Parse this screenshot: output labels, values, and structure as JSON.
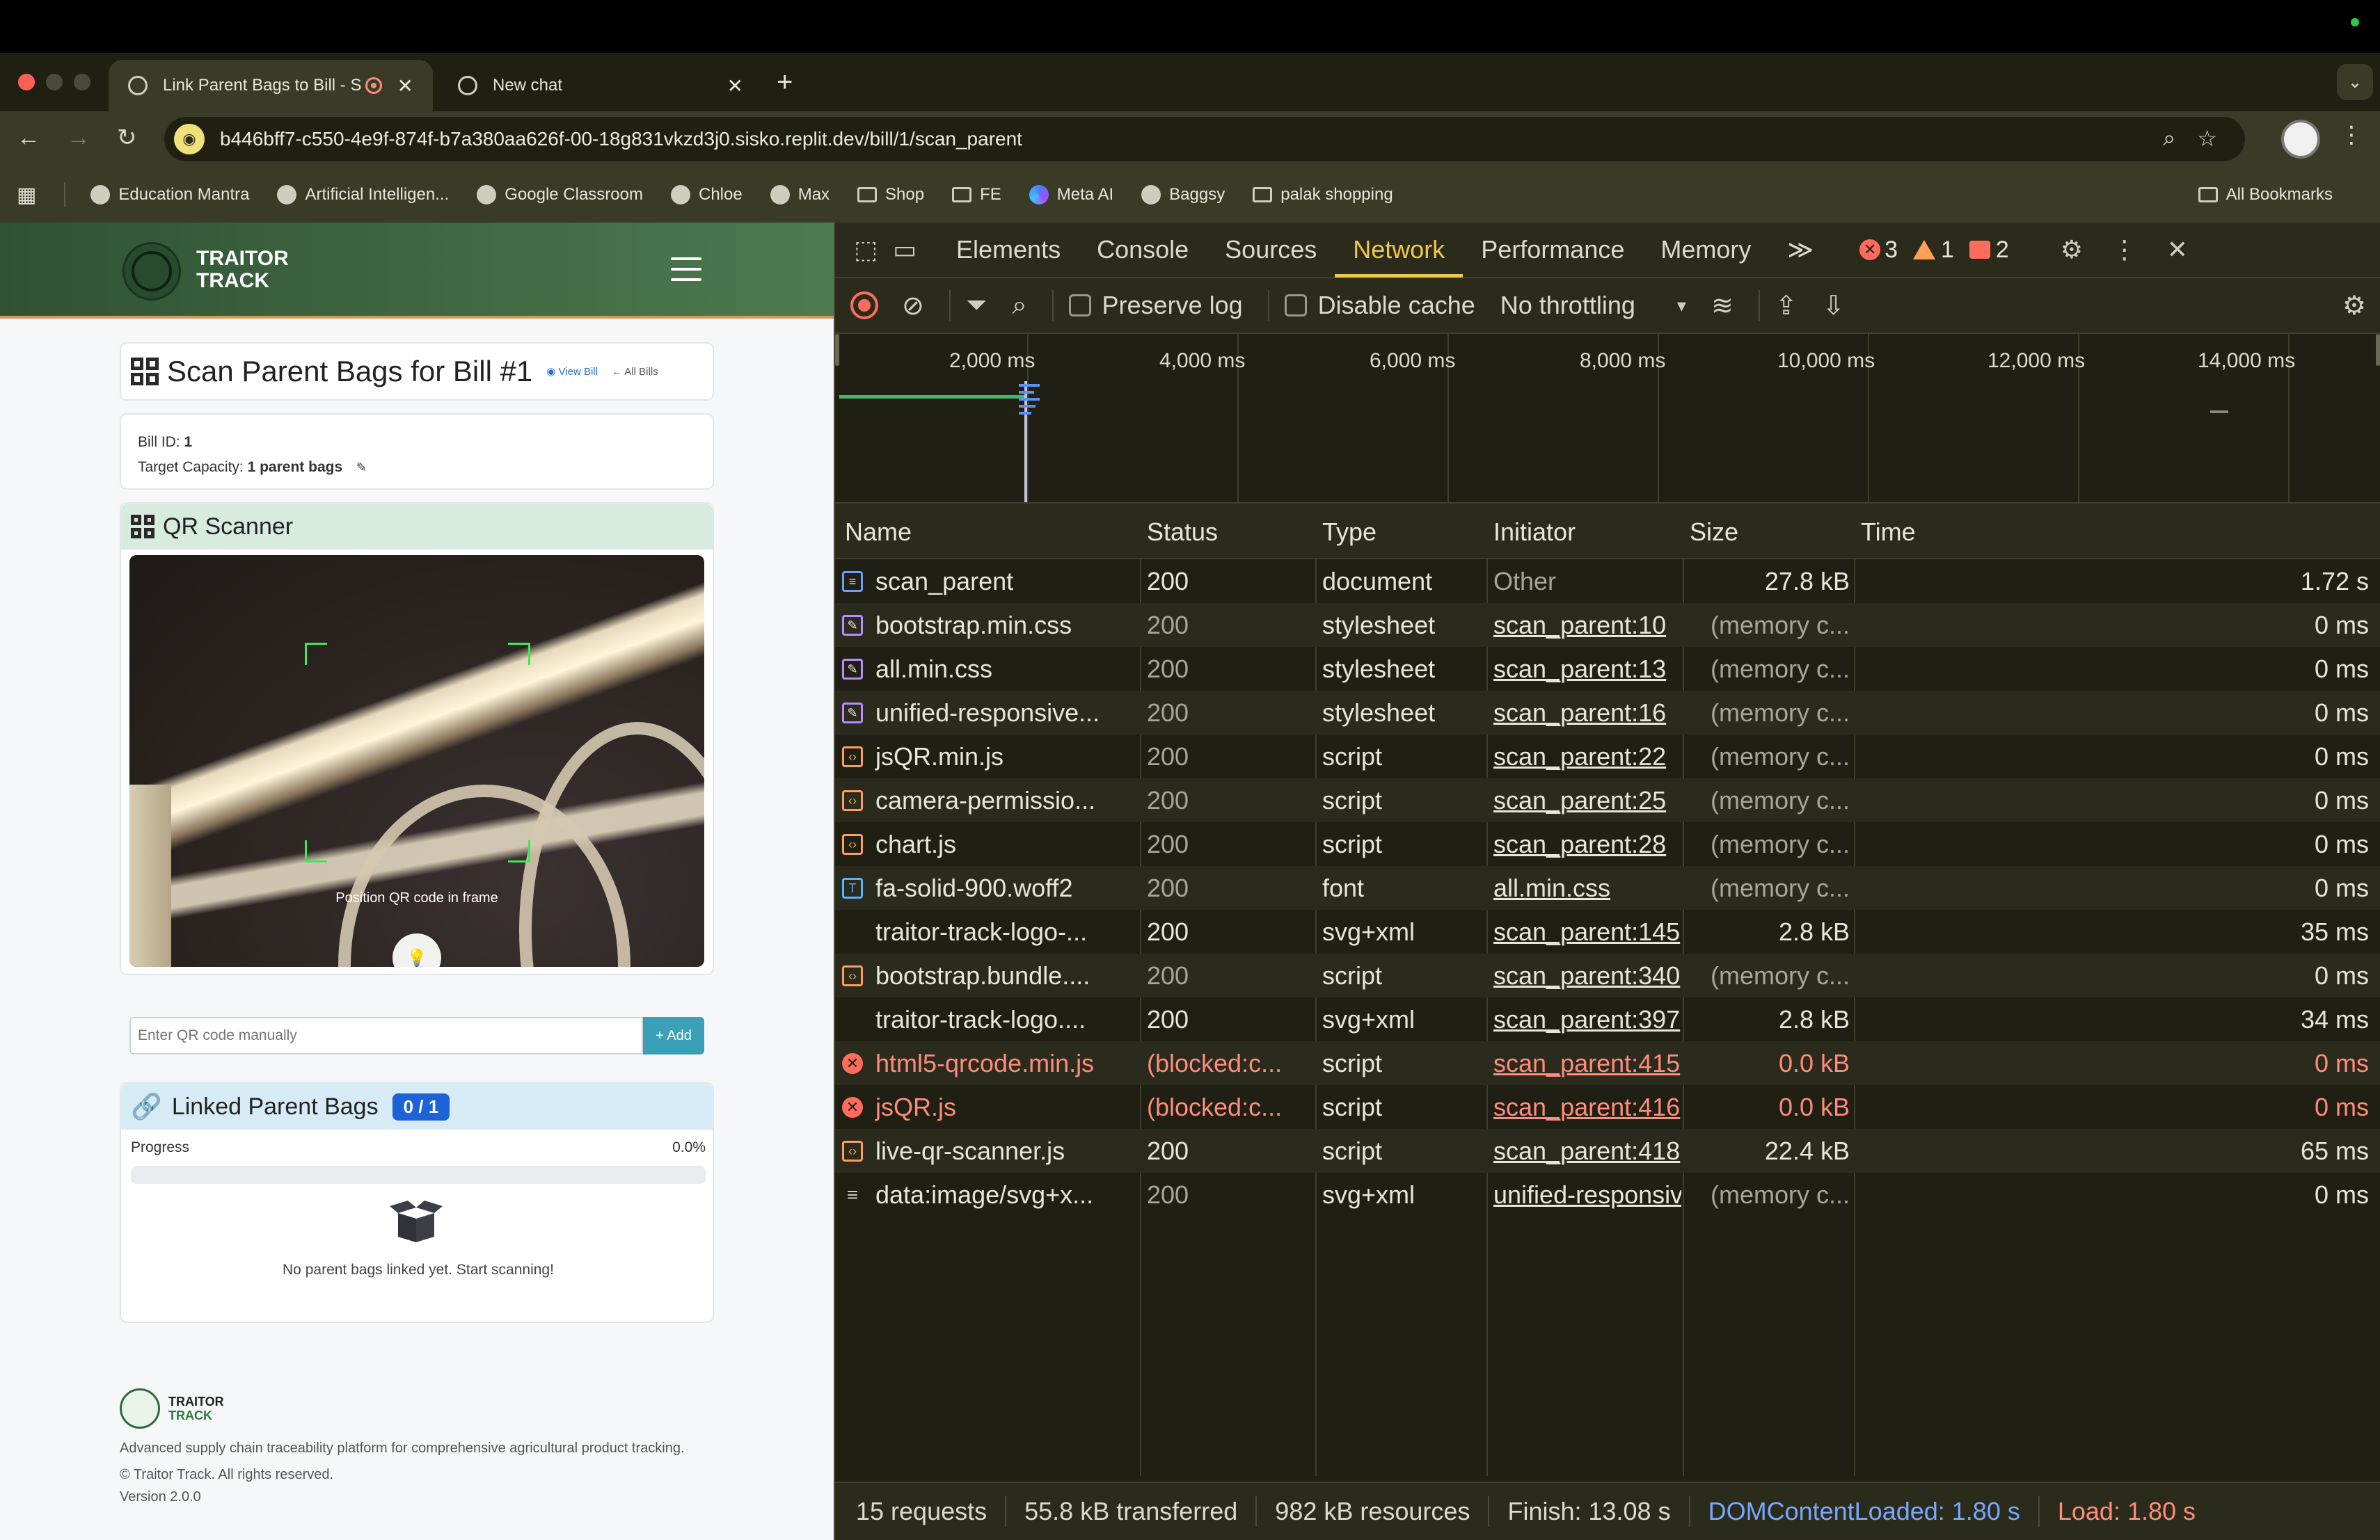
{
  "browser": {
    "tabs": [
      {
        "title": "Link Parent Bags to Bill - S",
        "active": true
      },
      {
        "title": "New chat",
        "active": false
      }
    ],
    "new_tab_label": "+",
    "tab_close": "✕",
    "url": "b446bff7-c550-4e9f-874f-b7a380aa626f-00-18g831vkzd3j0.sisko.replit.dev/bill/1/scan_parent",
    "bookmarks": [
      {
        "label": "Education Mantra",
        "icon": "globe-icon"
      },
      {
        "label": "Artificial Intelligen...",
        "icon": "globe-icon"
      },
      {
        "label": "Google Classroom",
        "icon": "globe-icon"
      },
      {
        "label": "Chloe",
        "icon": "globe-icon"
      },
      {
        "label": "Max",
        "icon": "globe-icon"
      },
      {
        "label": "Shop",
        "icon": "folder-icon"
      },
      {
        "label": "FE",
        "icon": "folder-icon"
      },
      {
        "label": "Meta AI",
        "icon": "meta-icon"
      },
      {
        "label": "Baggsy",
        "icon": "globe-icon"
      },
      {
        "label": "palak shopping",
        "icon": "folder-icon"
      }
    ],
    "all_bookmarks": "All Bookmarks"
  },
  "app": {
    "brand_line1": "TRAITOR",
    "brand_line2": "TRACK",
    "page_title": "Scan Parent Bags for Bill #1",
    "view_bill": "◉ View Bill",
    "all_bills": "← All Bills",
    "bill_id_label": "Bill ID:",
    "bill_id_value": "1",
    "capacity_label": "Target Capacity:",
    "capacity_value": "1 parent bags",
    "scanner_title": "QR Scanner",
    "camera_hint": "Position QR code in frame",
    "manual_placeholder": "Enter QR code manually",
    "add_button": "+ Add",
    "linked_title": "Linked Parent Bags",
    "linked_count": "0 / 1",
    "progress_label": "Progress",
    "progress_percent": "0.0%",
    "progress_value": 0.0,
    "empty_text": "No parent bags linked yet. Start scanning!",
    "footer_brand1": "TRAITOR",
    "footer_brand2": "TRACK",
    "footer_desc": "Advanced supply chain traceability platform for comprehensive agricultural product tracking.",
    "footer_copy": "© Traitor Track. All rights reserved.",
    "footer_version": "Version 2.0.0"
  },
  "devtools": {
    "tabs": [
      "Elements",
      "Console",
      "Sources",
      "Network",
      "Performance",
      "Memory"
    ],
    "active_tab": "Network",
    "more": "≫",
    "errors": "3",
    "warnings": "1",
    "issues": "2",
    "preserve_log": "Preserve log",
    "disable_cache": "Disable cache",
    "throttling": "No throttling",
    "overview_ticks": [
      "2,000 ms",
      "4,000 ms",
      "6,000 ms",
      "8,000 ms",
      "10,000 ms",
      "12,000 ms",
      "14,000 ms"
    ],
    "columns": [
      "Name",
      "Status",
      "Type",
      "Initiator",
      "Size",
      "Time"
    ],
    "requests": [
      {
        "name": "scan_parent",
        "status": "200",
        "type": "document",
        "initiator": "Other",
        "size": "27.8 kB",
        "time": "1.72 s",
        "icon": "doc",
        "kind": "ok sized",
        "plain": true
      },
      {
        "name": "bootstrap.min.css",
        "status": "200",
        "type": "stylesheet",
        "initiator": "scan_parent:10",
        "size": "(memory c...",
        "time": "0 ms",
        "icon": "css",
        "kind": ""
      },
      {
        "name": "all.min.css",
        "status": "200",
        "type": "stylesheet",
        "initiator": "scan_parent:13",
        "size": "(memory c...",
        "time": "0 ms",
        "icon": "css",
        "kind": ""
      },
      {
        "name": "unified-responsive...",
        "status": "200",
        "type": "stylesheet",
        "initiator": "scan_parent:16",
        "size": "(memory c...",
        "time": "0 ms",
        "icon": "css",
        "kind": ""
      },
      {
        "name": "jsQR.min.js",
        "status": "200",
        "type": "script",
        "initiator": "scan_parent:22",
        "size": "(memory c...",
        "time": "0 ms",
        "icon": "js",
        "kind": ""
      },
      {
        "name": "camera-permissio...",
        "status": "200",
        "type": "script",
        "initiator": "scan_parent:25",
        "size": "(memory c...",
        "time": "0 ms",
        "icon": "js",
        "kind": ""
      },
      {
        "name": "chart.js",
        "status": "200",
        "type": "script",
        "initiator": "scan_parent:28",
        "size": "(memory c...",
        "time": "0 ms",
        "icon": "js",
        "kind": ""
      },
      {
        "name": "fa-solid-900.woff2",
        "status": "200",
        "type": "font",
        "initiator": "all.min.css",
        "size": "(memory c...",
        "time": "0 ms",
        "icon": "font",
        "kind": ""
      },
      {
        "name": "traitor-track-logo-...",
        "status": "200",
        "type": "svg+xml",
        "initiator": "scan_parent:145",
        "size": "2.8 kB",
        "time": "35 ms",
        "icon": "img",
        "kind": "ok sized"
      },
      {
        "name": "bootstrap.bundle....",
        "status": "200",
        "type": "script",
        "initiator": "scan_parent:340",
        "size": "(memory c...",
        "time": "0 ms",
        "icon": "js",
        "kind": ""
      },
      {
        "name": "traitor-track-logo....",
        "status": "200",
        "type": "svg+xml",
        "initiator": "scan_parent:397",
        "size": "2.8 kB",
        "time": "34 ms",
        "icon": "img",
        "kind": "ok sized"
      },
      {
        "name": "html5-qrcode.min.js",
        "status": "(blocked:c...",
        "type": "script",
        "initiator": "scan_parent:415",
        "size": "0.0 kB",
        "time": "0 ms",
        "icon": "blocked",
        "kind": "err"
      },
      {
        "name": "jsQR.js",
        "status": "(blocked:c...",
        "type": "script",
        "initiator": "scan_parent:416",
        "size": "0.0 kB",
        "time": "0 ms",
        "icon": "blocked",
        "kind": "err"
      },
      {
        "name": "live-qr-scanner.js",
        "status": "200",
        "type": "script",
        "initiator": "scan_parent:418",
        "size": "22.4 kB",
        "time": "65 ms",
        "icon": "js",
        "kind": "ok sized"
      },
      {
        "name": "data:image/svg+x...",
        "status": "200",
        "type": "svg+xml",
        "initiator": "unified-responsiv",
        "size": "(memory c...",
        "time": "0 ms",
        "icon": "data",
        "kind": ""
      }
    ],
    "status": {
      "requests": "15 requests",
      "transferred": "55.8 kB transferred",
      "resources": "982 kB resources",
      "finish": "Finish: 13.08 s",
      "dcl": "DOMContentLoaded: 1.80 s",
      "load": "Load: 1.80 s"
    }
  }
}
